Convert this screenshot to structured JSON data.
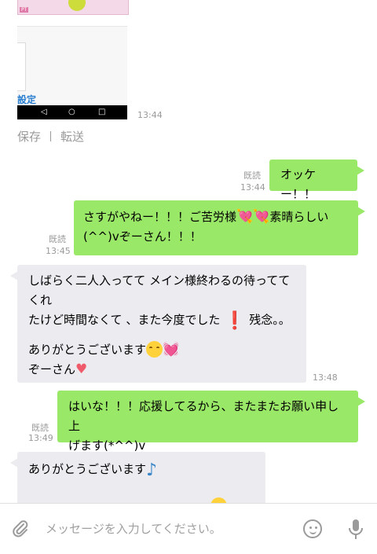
{
  "shared_image": {
    "pt_label": "PT",
    "setting_text": "設定",
    "time": "13:44"
  },
  "actions": {
    "save": "保存",
    "forward": "転送"
  },
  "messages": [
    {
      "direction": "out",
      "read": "既読",
      "time": "13:44",
      "text": "オッケー！！"
    },
    {
      "direction": "out",
      "read": "既読",
      "time": "13:45",
      "line1a": "さすがやねー！！！ご苦労様",
      "line1b": "素晴らしい",
      "line2": "(^^)vぞーさん！！！"
    },
    {
      "direction": "in",
      "time": "13:48",
      "line1": "しばらく二人入ってて メイン様終わるの待っててくれ",
      "line2a": "たけど時間なくて 、また今度でした",
      "line2b": "残念。。",
      "line3": "ありがとうございます",
      "line4": "ぞーさん"
    },
    {
      "direction": "out",
      "read": "既読",
      "time": "13:49",
      "line1": "はいな！！！応援してるから、またまたお願い申し上",
      "line2": "げます(*^^)v"
    },
    {
      "direction": "in",
      "line1": "ありがとうございます"
    }
  ],
  "input": {
    "placeholder": "メッセージを入力してください。"
  },
  "icons": {
    "heart_color": "#ef5b6a",
    "outgoing_bubble_color": "#9ae868",
    "incoming_bubble_color": "#ececf0"
  }
}
